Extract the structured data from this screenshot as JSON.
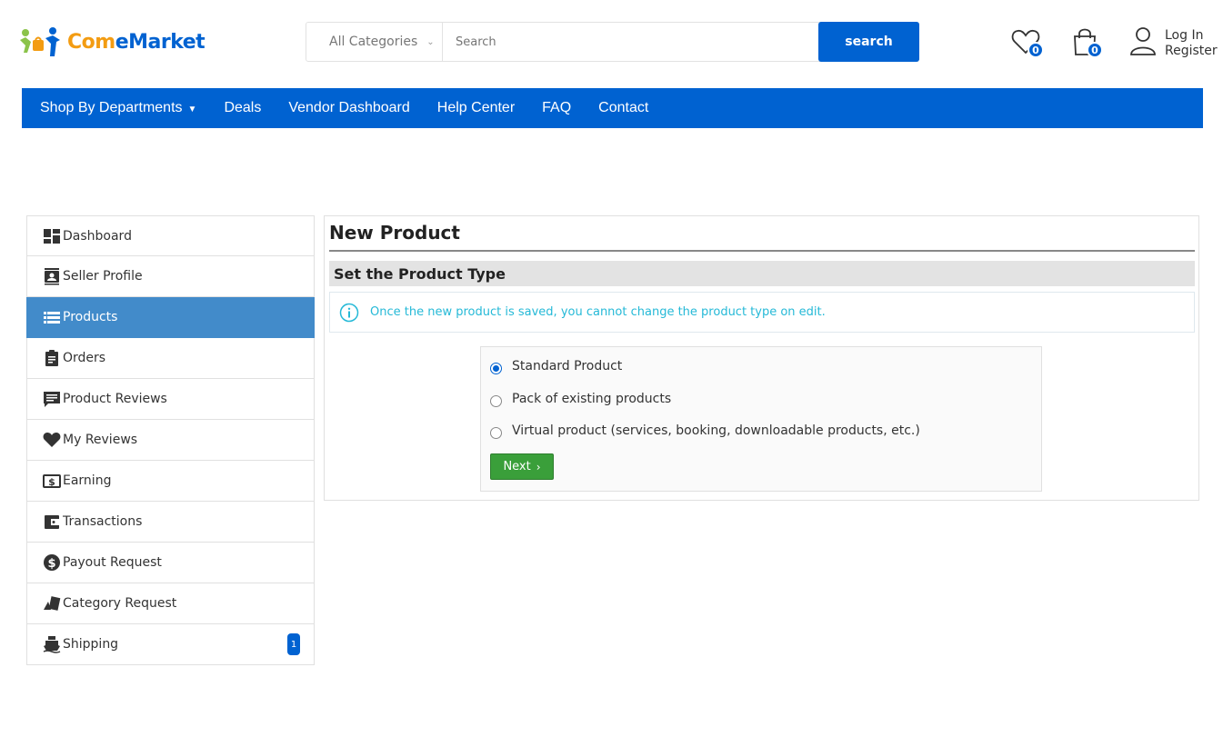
{
  "brand": {
    "name_part1": "Com",
    "name_part2": "eMarket"
  },
  "search": {
    "category": "All Categories",
    "placeholder": "Search",
    "button_label": "search"
  },
  "header": {
    "wishlist_count": "0",
    "cart_count": "0",
    "login_label": "Log In",
    "register_label": "Register"
  },
  "nav": {
    "items": [
      "Shop By Departments",
      "Deals",
      "Vendor Dashboard",
      "Help Center",
      "FAQ",
      "Contact"
    ]
  },
  "sidebar": {
    "items": [
      {
        "label": "Dashboard",
        "icon": "dashboard-icon"
      },
      {
        "label": "Seller Profile",
        "icon": "profile-icon"
      },
      {
        "label": "Products",
        "icon": "list-icon"
      },
      {
        "label": "Orders",
        "icon": "clipboard-icon"
      },
      {
        "label": "Product Reviews",
        "icon": "comment-icon"
      },
      {
        "label": "My Reviews",
        "icon": "heart-icon"
      },
      {
        "label": "Earning",
        "icon": "money-icon"
      },
      {
        "label": "Transactions",
        "icon": "wallet-icon"
      },
      {
        "label": "Payout Request",
        "icon": "dollar-icon"
      },
      {
        "label": "Category Request",
        "icon": "category-icon"
      },
      {
        "label": "Shipping",
        "icon": "ship-icon",
        "badge": "1"
      }
    ],
    "active_index": 2
  },
  "main": {
    "title": "New Product",
    "section_title": "Set the Product Type",
    "info_text": "Once the new product is saved, you cannot change the product type on edit.",
    "options": [
      "Standard Product",
      "Pack of existing products",
      "Virtual product (services, booking, downloadable products, etc.)"
    ],
    "selected_option": 0,
    "next_label": "Next"
  },
  "colors": {
    "primary": "#0062d1",
    "active_item": "#428bca",
    "info": "#25b9d7",
    "next_button": "#3a9f3a"
  }
}
